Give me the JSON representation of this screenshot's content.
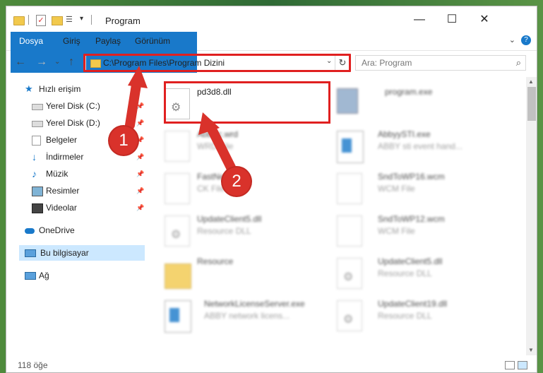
{
  "window": {
    "title": "Program"
  },
  "ribbon": {
    "tabs": [
      "Dosya",
      "Giriş",
      "Paylaş",
      "Görünüm"
    ],
    "help": "?"
  },
  "address": {
    "path": "C:\\Program Files\\Program Dizini",
    "refresh": "↻",
    "dropdown": "⌄"
  },
  "search": {
    "placeholder": "Ara: Program",
    "icon": "⌕"
  },
  "nav": {
    "back": "←",
    "forward": "→",
    "recent": "⌄",
    "up": "↑"
  },
  "sidebar": {
    "items": [
      {
        "label": "Hızlı erişim"
      },
      {
        "label": "Yerel Disk (C:)"
      },
      {
        "label": "Yerel Disk (D:)"
      },
      {
        "label": "Belgeler"
      },
      {
        "label": "İndirmeler"
      },
      {
        "label": "Müzik"
      },
      {
        "label": "Resimler"
      },
      {
        "label": "Videolar"
      },
      {
        "label": "OneDrive"
      },
      {
        "label": "Bu bilgisayar"
      },
      {
        "label": "Ağ"
      }
    ]
  },
  "files": {
    "left": [
      {
        "name": "pd3d8.dll",
        "type": ""
      },
      {
        "name": "AbbSc.wrd",
        "type": "WRD File"
      },
      {
        "name": "FastNet",
        "type": "CK File"
      },
      {
        "name": "UpdateClient5.dll",
        "type": "Resource DLL"
      },
      {
        "name": "Resource",
        "type": ""
      },
      {
        "name": "NetworkLicenseServer.exe",
        "type": "ABBY network licens..."
      }
    ],
    "right": [
      {
        "name": "program.exe",
        "type": ""
      },
      {
        "name": "AbbyySTI.exe",
        "type": "ABBY sti event hand..."
      },
      {
        "name": "SndToWP16.wcm",
        "type": "WCM File"
      },
      {
        "name": "SndToWP12.wcm",
        "type": "WCM File"
      },
      {
        "name": "UpdateClient5.dll",
        "type": "Resource DLL"
      },
      {
        "name": "UpdateClient19.dll",
        "type": "Resource DLL"
      }
    ]
  },
  "status": {
    "count": "118 öğe"
  },
  "callouts": {
    "one": "1",
    "two": "2"
  },
  "colors": {
    "accent": "#1979ca",
    "highlight": "#e02020",
    "callout": "#d9322b"
  }
}
